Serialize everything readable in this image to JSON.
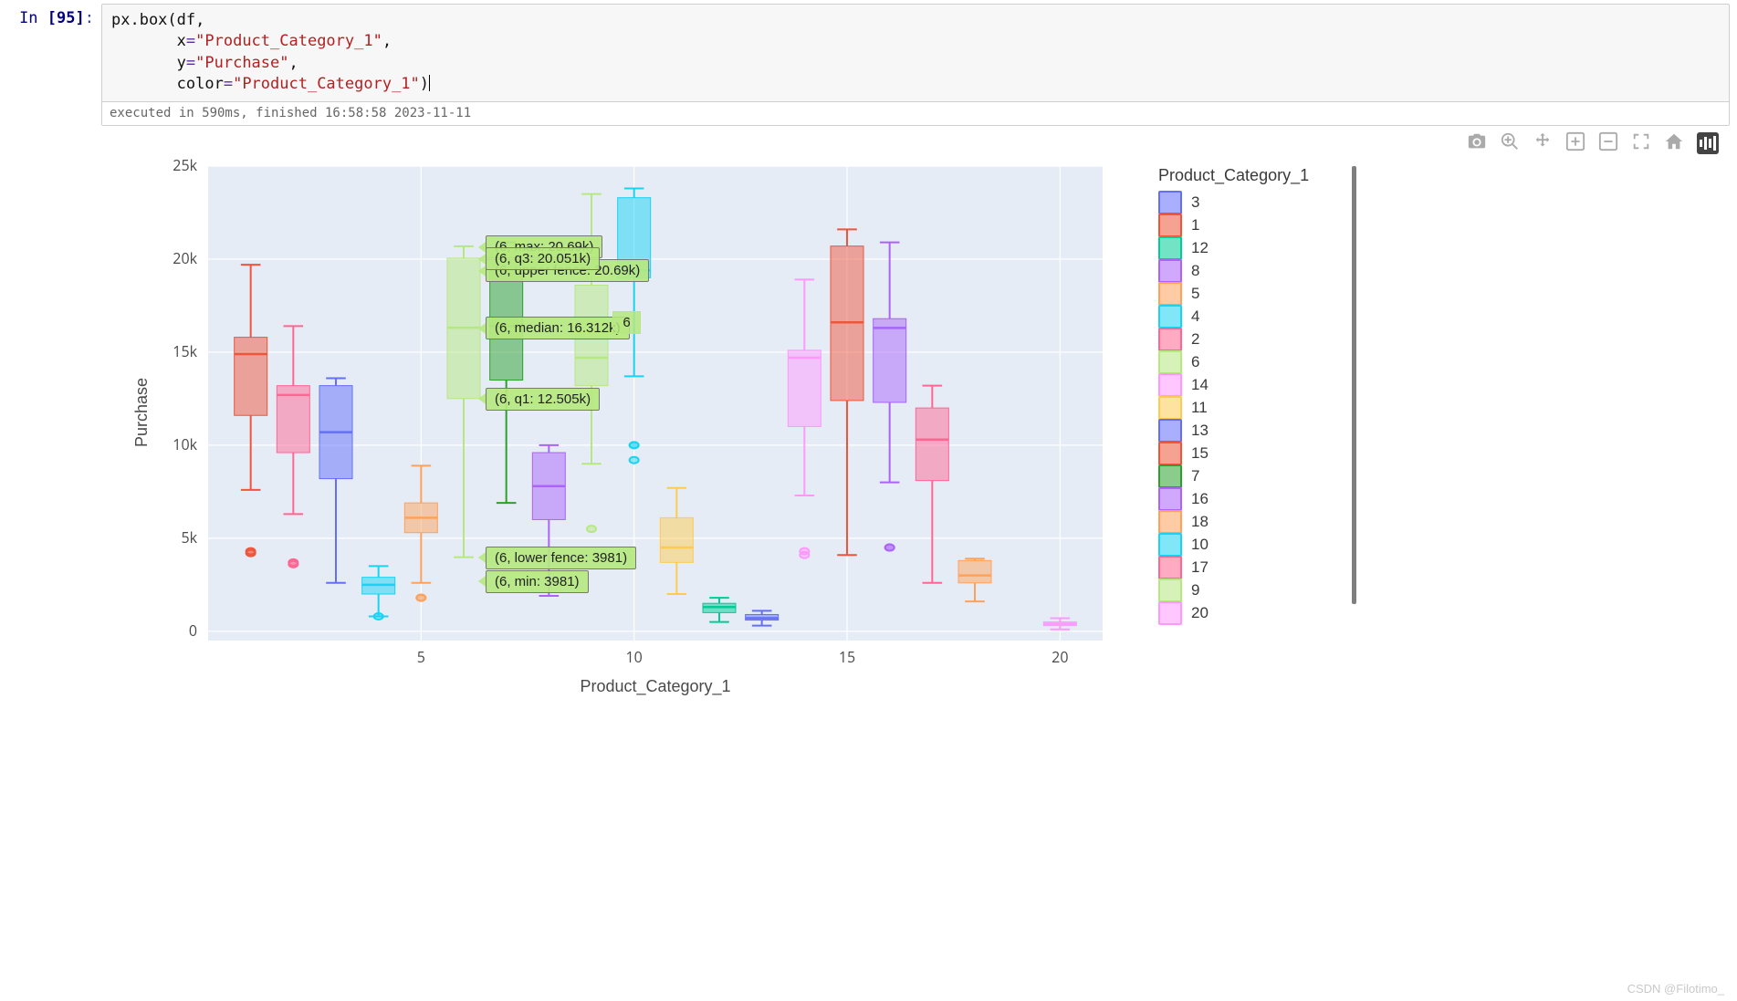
{
  "cell": {
    "prompt_label": "In",
    "prompt_number": "[95]",
    "prompt_colon": ":",
    "code_lines": [
      [
        {
          "t": "px.box",
          "c": "tok-fn"
        },
        {
          "t": "(",
          "c": "tok-paren"
        },
        {
          "t": "df,",
          "c": "tok-fn"
        }
      ],
      [
        {
          "t": "       x",
          "c": "tok-fn"
        },
        {
          "t": "=",
          "c": "tok-eq"
        },
        {
          "t": "\"Product_Category_1\"",
          "c": "tok-str"
        },
        {
          "t": ",",
          "c": "tok-fn"
        }
      ],
      [
        {
          "t": "       y",
          "c": "tok-fn"
        },
        {
          "t": "=",
          "c": "tok-eq"
        },
        {
          "t": "\"Purchase\"",
          "c": "tok-str"
        },
        {
          "t": ",",
          "c": "tok-fn"
        }
      ],
      [
        {
          "t": "       color",
          "c": "tok-fn"
        },
        {
          "t": "=",
          "c": "tok-eq"
        },
        {
          "t": "\"Product_Category_1\"",
          "c": "tok-str"
        },
        {
          "t": ")",
          "c": "tok-paren"
        }
      ]
    ],
    "exec_status": "executed in 590ms, finished 16:58:58 2023-11-11"
  },
  "modebar": {
    "items": [
      "camera-icon",
      "zoom-icon",
      "pan-icon",
      "zoom-in-icon",
      "zoom-out-icon",
      "autoscale-icon",
      "home-icon",
      "plotly-logo"
    ]
  },
  "chart_data": {
    "type": "box",
    "title": "",
    "xlabel": "Product_Category_1",
    "ylabel": "Purchase",
    "x_ticks": [
      5,
      10,
      15,
      20
    ],
    "y_ticks": [
      0,
      5000,
      10000,
      15000,
      20000,
      25000
    ],
    "y_tick_labels": [
      "0",
      "5k",
      "10k",
      "15k",
      "20k",
      "25k"
    ],
    "ylim": [
      -500,
      25000
    ],
    "xlim": [
      0,
      21
    ],
    "plot_bg": "#E5ECF6",
    "legend_title": "Product_Category_1",
    "legend_order": [
      3,
      1,
      12,
      8,
      5,
      4,
      2,
      6,
      14,
      11,
      13,
      15,
      7,
      16,
      18,
      10,
      17,
      9,
      20
    ],
    "colors": {
      "1": "#ef553b",
      "2": "#ff6692",
      "3": "#636efa",
      "4": "#19d3f3",
      "5": "#ffa15a",
      "6": "#b6e880",
      "7": "#2ca02c",
      "8": "#ab63fa",
      "9": "#b6e880",
      "10": "#19d3f3",
      "11": "#fecb52",
      "12": "#00cc96",
      "13": "#636efa",
      "14": "#ff97ff",
      "15": "#ef553b",
      "16": "#ab63fa",
      "17": "#ff6692",
      "18": "#ffa15a",
      "20": "#ff97ff"
    },
    "boxes": {
      "1": {
        "min": 7600,
        "q1": 11600,
        "median": 14900,
        "q3": 15800,
        "max": 19700,
        "outliers": [
          4300,
          4200
        ]
      },
      "2": {
        "min": 6300,
        "q1": 9600,
        "median": 12700,
        "q3": 13200,
        "max": 16400,
        "outliers": [
          3700,
          3600
        ]
      },
      "3": {
        "min": 2600,
        "q1": 8200,
        "median": 10700,
        "q3": 13200,
        "max": 13600,
        "outliers": []
      },
      "4": {
        "min": 800,
        "q1": 2000,
        "median": 2500,
        "q3": 2900,
        "max": 3500,
        "outliers": [
          800
        ]
      },
      "5": {
        "min": 2600,
        "q1": 5300,
        "median": 6100,
        "q3": 6900,
        "max": 8900,
        "outliers": [
          1800,
          1800
        ]
      },
      "6": {
        "min": 3981,
        "q1": 12505,
        "median": 16312,
        "q3": 20051,
        "max": 20690,
        "outliers": []
      },
      "7": {
        "min": 6900,
        "q1": 13500,
        "median": 16400,
        "q3": 19800,
        "max": 20900,
        "outliers": []
      },
      "8": {
        "min": 1900,
        "q1": 6000,
        "median": 7800,
        "q3": 9600,
        "max": 10000,
        "outliers": []
      },
      "9": {
        "min": 9000,
        "q1": 13200,
        "median": 14700,
        "q3": 18600,
        "max": 23500,
        "outliers": [
          5500
        ]
      },
      "10": {
        "min": 13700,
        "q1": 19000,
        "median": 19400,
        "q3": 23300,
        "max": 23800,
        "outliers": [
          9200,
          10000,
          10000
        ]
      },
      "11": {
        "min": 2000,
        "q1": 3700,
        "median": 4500,
        "q3": 6100,
        "max": 7700,
        "outliers": []
      },
      "12": {
        "min": 500,
        "q1": 1000,
        "median": 1300,
        "q3": 1500,
        "max": 1800,
        "outliers": []
      },
      "13": {
        "min": 300,
        "q1": 600,
        "median": 700,
        "q3": 900,
        "max": 1100,
        "outliers": []
      },
      "14": {
        "min": 7300,
        "q1": 11000,
        "median": 14700,
        "q3": 15100,
        "max": 18900,
        "outliers": [
          4100,
          4300
        ]
      },
      "15": {
        "min": 4100,
        "q1": 12400,
        "median": 16600,
        "q3": 20700,
        "max": 21600,
        "outliers": []
      },
      "16": {
        "min": 8000,
        "q1": 12300,
        "median": 16300,
        "q3": 16800,
        "max": 20900,
        "outliers": [
          4500,
          4500
        ]
      },
      "17": {
        "min": 2600,
        "q1": 8100,
        "median": 10300,
        "q3": 12000,
        "max": 13200,
        "outliers": []
      },
      "18": {
        "min": 1600,
        "q1": 2600,
        "median": 3000,
        "q3": 3800,
        "max": 3900,
        "outliers": []
      },
      "20": {
        "min": 100,
        "q1": 300,
        "median": 400,
        "q3": 500,
        "max": 700,
        "outliers": []
      }
    },
    "hover": {
      "category": "6",
      "tags": [
        {
          "stat": "max",
          "text": "(6, max: 20.69k)"
        },
        {
          "stat": "upper_fence",
          "text": "(6, upper fence: 20.69k)"
        },
        {
          "stat": "q3",
          "text": "(6, q3: 20.051k)"
        },
        {
          "stat": "median",
          "text": "(6, median: 16.312k)"
        },
        {
          "stat": "q1",
          "text": "(6, q1: 12.505k)"
        },
        {
          "stat": "lower_fence",
          "text": "(6, lower fence: 3981)"
        },
        {
          "stat": "min",
          "text": "(6, min: 3981)"
        }
      ],
      "x_label": "6"
    }
  },
  "watermark": "CSDN @Filotimo_"
}
